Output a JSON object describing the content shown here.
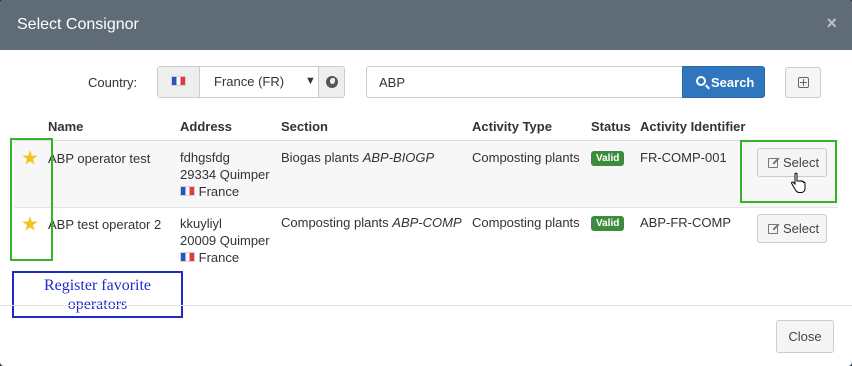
{
  "dialog": {
    "title": "Select Consignor",
    "close_glyph": "×"
  },
  "search": {
    "country_label": "Country:",
    "country_value": "France (FR)",
    "query": "ABP",
    "button_label": "Search"
  },
  "table": {
    "headers": [
      "Name",
      "Address",
      "Section",
      "Activity Type",
      "Status",
      "Activity Identifier"
    ],
    "rows": [
      {
        "name": "ABP operator test",
        "address_line1": "fdhgsfdg",
        "address_line2": "29334 Quimper",
        "country": "France",
        "section_name": "Biogas plants",
        "section_code": "ABP-BIOGP",
        "activity_type": "Composting plants",
        "status": "Valid",
        "activity_identifier": "FR-COMP-001",
        "select_label": "Select"
      },
      {
        "name": "ABP test operator 2",
        "address_line1": "kkuyliyl",
        "address_line2": "20009 Quimper",
        "country": "France",
        "section_name": "Composting plants",
        "section_code": "ABP-COMP",
        "activity_type": "Composting plants",
        "status": "Valid",
        "activity_identifier": "ABP-FR-COMP",
        "select_label": "Select"
      }
    ]
  },
  "annotation": {
    "line1": "Register favorite",
    "line2": "operators"
  },
  "footer": {
    "close_label": "Close"
  },
  "colors": {
    "header_bg": "#5f6b76",
    "primary": "#2f76be",
    "valid_badge": "#3d8b3d",
    "star": "#f2c318",
    "highlight_box": "#35b329",
    "callout": "#1f2cc9"
  }
}
